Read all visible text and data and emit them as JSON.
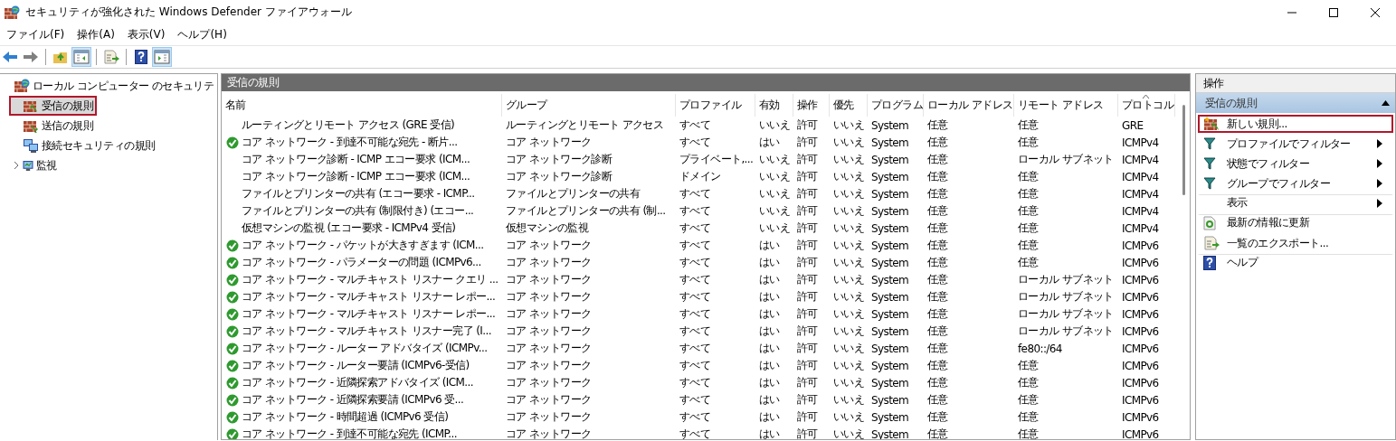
{
  "window": {
    "title": "セキュリティが強化された Windows Defender ファイアウォール"
  },
  "menu": [
    "ファイル(F)",
    "操作(A)",
    "表示(V)",
    "ヘルプ(H)"
  ],
  "toolbar": [
    {
      "kind": "back",
      "pressed": false
    },
    {
      "kind": "forward",
      "pressed": false
    },
    {
      "kind": "separator"
    },
    {
      "kind": "up",
      "pressed": false
    },
    {
      "kind": "tree",
      "pressed": true
    },
    {
      "kind": "separator"
    },
    {
      "kind": "export",
      "pressed": false
    },
    {
      "kind": "separator"
    },
    {
      "kind": "help",
      "pressed": false
    },
    {
      "kind": "actions",
      "pressed": true
    }
  ],
  "tree": [
    {
      "label": "ローカル コンピューター のセキュリテ",
      "kind": "root",
      "selected": false,
      "highlighted": false,
      "children": [
        {
          "label": "受信の規則",
          "kind": "inbound",
          "selected": true,
          "highlighted": true
        },
        {
          "label": "送信の規則",
          "kind": "outbound",
          "selected": false,
          "highlighted": false
        },
        {
          "label": "接続セキュリティの規則",
          "kind": "connection",
          "selected": false,
          "highlighted": false
        },
        {
          "label": "監視",
          "kind": "monitor",
          "expanded": false,
          "selected": false,
          "highlighted": false,
          "has_children": true
        }
      ]
    }
  ],
  "content": {
    "title": "受信の規則",
    "table": {
      "columns": [
        {
          "label": "名前",
          "sorted": false
        },
        {
          "label": "グループ",
          "sorted": false
        },
        {
          "label": "プロファイル",
          "sorted": false
        },
        {
          "label": "有効",
          "sorted": false
        },
        {
          "label": "操作",
          "sorted": false
        },
        {
          "label": "優先",
          "sorted": false
        },
        {
          "label": "プログラム",
          "sorted": false
        },
        {
          "label": "ローカル アドレス",
          "sorted": false
        },
        {
          "label": "リモート アドレス",
          "sorted": false
        },
        {
          "label": "プロトコル",
          "sorted": true
        }
      ],
      "rows": [
        {
          "active": false,
          "cells": [
            "ルーティングとリモート アクセス (GRE 受信)",
            "ルーティングとリモート アクセス",
            "すべて",
            "いいえ",
            "許可",
            "いいえ",
            "System",
            "任意",
            "任意",
            "GRE"
          ]
        },
        {
          "active": true,
          "cells": [
            "コア ネットワーク - 到達不可能な宛先 - 断片...",
            "コア ネットワーク",
            "すべて",
            "はい",
            "許可",
            "いいえ",
            "System",
            "任意",
            "任意",
            "ICMPv4"
          ]
        },
        {
          "active": false,
          "cells": [
            "コア ネットワーク診断 - ICMP エコー要求 (ICM...",
            "コア ネットワーク診断",
            "プライベート,...",
            "いいえ",
            "許可",
            "いいえ",
            "System",
            "任意",
            "ローカル サブネット",
            "ICMPv4"
          ]
        },
        {
          "active": false,
          "cells": [
            "コア ネットワーク診断 - ICMP エコー要求 (ICM...",
            "コア ネットワーク診断",
            "ドメイン",
            "いいえ",
            "許可",
            "いいえ",
            "System",
            "任意",
            "任意",
            "ICMPv4"
          ]
        },
        {
          "active": false,
          "cells": [
            "ファイルとプリンターの共有 (エコー要求 - ICMP...",
            "ファイルとプリンターの共有",
            "すべて",
            "いいえ",
            "許可",
            "いいえ",
            "System",
            "任意",
            "任意",
            "ICMPv4"
          ]
        },
        {
          "active": false,
          "cells": [
            "ファイルとプリンターの共有 (制限付き) (エコー...",
            "ファイルとプリンターの共有 (制...",
            "すべて",
            "いいえ",
            "許可",
            "いいえ",
            "System",
            "任意",
            "任意",
            "ICMPv4"
          ]
        },
        {
          "active": false,
          "cells": [
            "仮想マシンの監視 (エコー要求 - ICMPv4 受信)",
            "仮想マシンの監視",
            "すべて",
            "いいえ",
            "許可",
            "いいえ",
            "System",
            "任意",
            "任意",
            "ICMPv4"
          ]
        },
        {
          "active": true,
          "cells": [
            "コア ネットワーク - パケットが大きすぎます (ICM...",
            "コア ネットワーク",
            "すべて",
            "はい",
            "許可",
            "いいえ",
            "System",
            "任意",
            "任意",
            "ICMPv6"
          ]
        },
        {
          "active": true,
          "cells": [
            "コア ネットワーク - パラメーターの問題 (ICMPv6...",
            "コア ネットワーク",
            "すべて",
            "はい",
            "許可",
            "いいえ",
            "System",
            "任意",
            "任意",
            "ICMPv6"
          ]
        },
        {
          "active": true,
          "cells": [
            "コア ネットワーク - マルチキャスト リスナー クエリ ...",
            "コア ネットワーク",
            "すべて",
            "はい",
            "許可",
            "いいえ",
            "System",
            "任意",
            "ローカル サブネット",
            "ICMPv6"
          ]
        },
        {
          "active": true,
          "cells": [
            "コア ネットワーク - マルチキャスト リスナー レポー...",
            "コア ネットワーク",
            "すべて",
            "はい",
            "許可",
            "いいえ",
            "System",
            "任意",
            "ローカル サブネット",
            "ICMPv6"
          ]
        },
        {
          "active": true,
          "cells": [
            "コア ネットワーク - マルチキャスト リスナー レポー...",
            "コア ネットワーク",
            "すべて",
            "はい",
            "許可",
            "いいえ",
            "System",
            "任意",
            "ローカル サブネット",
            "ICMPv6"
          ]
        },
        {
          "active": true,
          "cells": [
            "コア ネットワーク - マルチキャスト リスナー完了 (I...",
            "コア ネットワーク",
            "すべて",
            "はい",
            "許可",
            "いいえ",
            "System",
            "任意",
            "ローカル サブネット",
            "ICMPv6"
          ]
        },
        {
          "active": true,
          "cells": [
            "コア ネットワーク - ルーター アドバタイズ (ICMPv...",
            "コア ネットワーク",
            "すべて",
            "はい",
            "許可",
            "いいえ",
            "System",
            "任意",
            "fe80::/64",
            "ICMPv6"
          ]
        },
        {
          "active": true,
          "cells": [
            "コア ネットワーク - ルーター要請 (ICMPv6-受信)",
            "コア ネットワーク",
            "すべて",
            "はい",
            "許可",
            "いいえ",
            "System",
            "任意",
            "任意",
            "ICMPv6"
          ]
        },
        {
          "active": true,
          "cells": [
            "コア ネットワーク - 近隣探索アドバタイズ (ICM...",
            "コア ネットワーク",
            "すべて",
            "はい",
            "許可",
            "いいえ",
            "System",
            "任意",
            "任意",
            "ICMPv6"
          ]
        },
        {
          "active": true,
          "cells": [
            "コア ネットワーク - 近隣探索要請 (ICMPv6 受...",
            "コア ネットワーク",
            "すべて",
            "はい",
            "許可",
            "いいえ",
            "System",
            "任意",
            "任意",
            "ICMPv6"
          ]
        },
        {
          "active": true,
          "cells": [
            "コア ネットワーク - 時間超過 (ICMPv6 受信)",
            "コア ネットワーク",
            "すべて",
            "はい",
            "許可",
            "いいえ",
            "System",
            "任意",
            "任意",
            "ICMPv6"
          ]
        },
        {
          "active": true,
          "cells": [
            "コア ネットワーク - 到達不可能な宛先 (ICMP...",
            "コア ネットワーク",
            "すべて",
            "はい",
            "許可",
            "いいえ",
            "System",
            "任意",
            "任意",
            "ICMPv6"
          ]
        }
      ]
    }
  },
  "actions": {
    "title": "操作",
    "section": {
      "title": "受信の規則",
      "expanded": true
    },
    "items": [
      {
        "label": "新しい規則...",
        "kind": "new-rule",
        "submenu": false,
        "divider_above": false,
        "highlighted": true
      },
      {
        "label": "プロファイルでフィルター",
        "kind": "filter",
        "submenu": true,
        "divider_above": false,
        "highlighted": false
      },
      {
        "label": "状態でフィルター",
        "kind": "filter",
        "submenu": true,
        "divider_above": false,
        "highlighted": false
      },
      {
        "label": "グループでフィルター",
        "kind": "filter",
        "submenu": true,
        "divider_above": false,
        "highlighted": false
      },
      {
        "label": "表示",
        "kind": "none",
        "submenu": true,
        "divider_above": true,
        "highlighted": false
      },
      {
        "label": "最新の情報に更新",
        "kind": "refresh",
        "submenu": false,
        "divider_above": true,
        "highlighted": false
      },
      {
        "label": "一覧のエクスポート...",
        "kind": "export",
        "submenu": false,
        "divider_above": false,
        "highlighted": false
      },
      {
        "label": "ヘルプ",
        "kind": "help",
        "submenu": false,
        "divider_above": true,
        "highlighted": false
      }
    ]
  }
}
